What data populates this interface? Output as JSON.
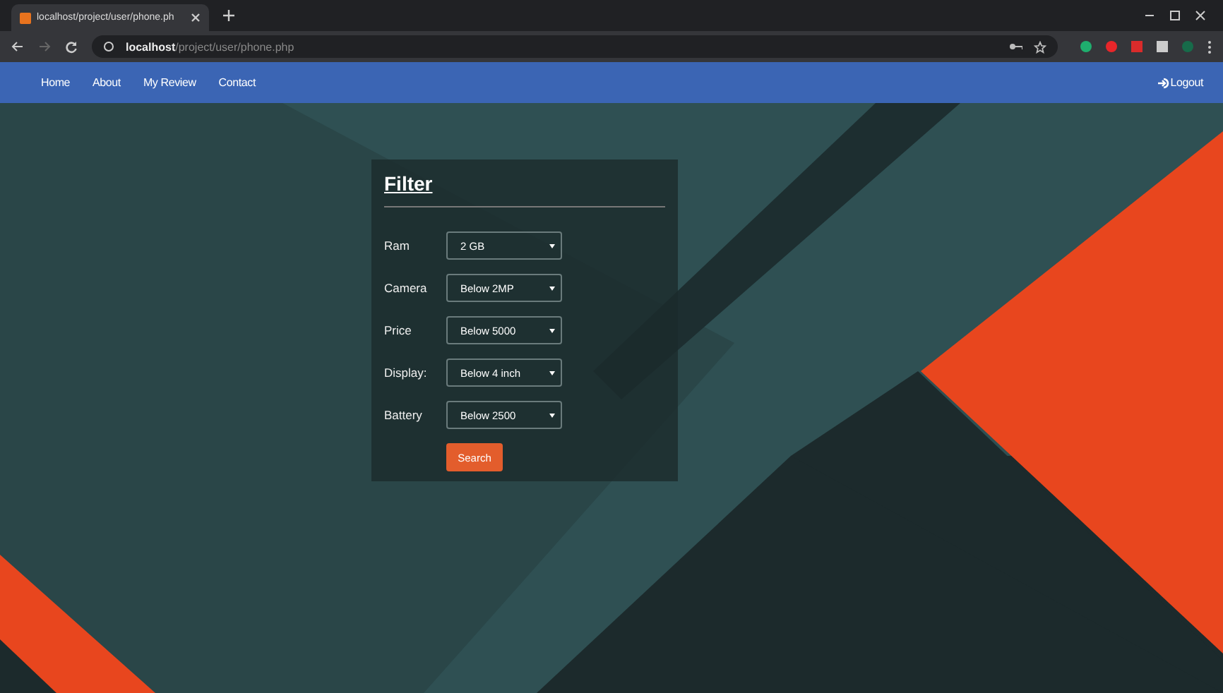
{
  "browser": {
    "tab_title": "localhost/project/user/phone.ph",
    "url_host": "localhost",
    "url_path": "/project/user/phone.php"
  },
  "nav": {
    "links": [
      {
        "label": "Home"
      },
      {
        "label": "About"
      },
      {
        "label": "My Review"
      },
      {
        "label": "Contact"
      }
    ],
    "logout": "Logout"
  },
  "filter": {
    "title": "Filter",
    "fields": [
      {
        "label": "Ram",
        "value": "2 GB"
      },
      {
        "label": "Camera",
        "value": "Below 2MP"
      },
      {
        "label": "Price",
        "value": "Below 5000"
      },
      {
        "label": "Display:",
        "value": "Below 4 inch"
      },
      {
        "label": "Battery",
        "value": "Below 2500"
      }
    ],
    "button": "Search"
  }
}
